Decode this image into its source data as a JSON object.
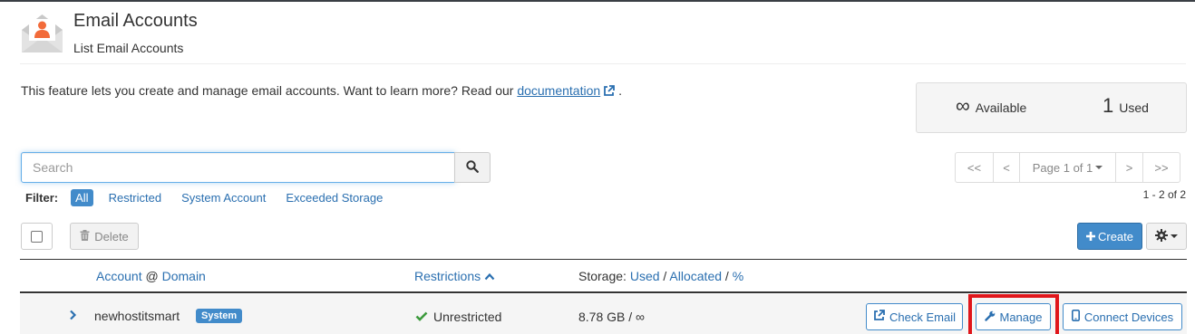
{
  "header": {
    "title": "Email Accounts",
    "subtitle": "List Email Accounts"
  },
  "intro": {
    "text": "This feature lets you create and manage email accounts. Want to learn more? Read our ",
    "link": "documentation",
    "suffix": "."
  },
  "stats": {
    "available_value": "∞",
    "available_label": "Available",
    "used_value": "1",
    "used_label": "Used"
  },
  "search": {
    "placeholder": "Search",
    "value": ""
  },
  "filter": {
    "label": "Filter:",
    "items": [
      "All",
      "Restricted",
      "System Account",
      "Exceeded Storage"
    ],
    "active": "All"
  },
  "pagination": {
    "first": "<<",
    "prev": "<",
    "page": "Page 1 of 1",
    "next": ">",
    "last": ">>",
    "count": "1 - 2 of 2"
  },
  "toolbar": {
    "delete_label": "Delete",
    "create_label": "Create"
  },
  "table": {
    "col_account": "Account",
    "col_at": "@",
    "col_domain": "Domain",
    "col_restrictions": "Restrictions",
    "col_storage_prefix": "Storage:",
    "col_storage_used": "Used",
    "col_storage_sep": "/",
    "col_storage_allocated": "Allocated",
    "col_storage_pct": "%",
    "rows": [
      {
        "account": "newhostitsmart",
        "badge": "System",
        "restriction": "Unrestricted",
        "storage": "8.78 GB / ∞",
        "actions": {
          "check_email": "Check Email",
          "manage": "Manage",
          "connect_devices": "Connect Devices"
        }
      }
    ]
  },
  "colors": {
    "accent": "#428bca",
    "link": "#2a6fb0",
    "success": "#3c9a3c",
    "highlight": "#e0161b"
  }
}
